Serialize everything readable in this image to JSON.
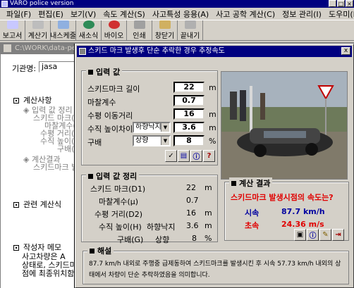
{
  "app": {
    "title": "VARO police version"
  },
  "menu": [
    "파일(F)",
    "편집(E)",
    "보기(V)",
    "속도 계산(S)",
    "사고특성 응용(A)",
    "사고 공학 계산(C)",
    "정보 관리(I)",
    "도우미(H)"
  ],
  "toolbar": [
    {
      "label": "보고서",
      "icon": "report-icon",
      "color": "#c8c8ff"
    },
    {
      "label": "계산기",
      "icon": "calculator-icon",
      "color": "#bdbdbd"
    },
    {
      "label": "내스케줄",
      "icon": "schedule-icon",
      "color": "#8fb0e0"
    },
    {
      "label": "새소식",
      "icon": "globe-icon",
      "color": "#2e8b57"
    },
    {
      "label": "바이오",
      "icon": "bio-icon",
      "color": "#d03030"
    },
    {
      "label": "인쇄",
      "icon": "print-icon",
      "color": "#a0a0a0"
    },
    {
      "label": "창닫기",
      "icon": "close-window-icon",
      "color": "#d0b060"
    },
    {
      "label": "끝내기",
      "icon": "exit-icon",
      "color": "#b0b0b0"
    }
  ],
  "doc": {
    "title": "C:\\WORK\\data-ped",
    "agency_label": "기관명:",
    "agency_value": "jasa",
    "section_calc": "계산사항",
    "calc_lines": [
      "입력 값 정리",
      "스키드 마크(D",
      "마찰계수(",
      "수평 거리(D",
      "수직 높이(H",
      "구배("
    ],
    "result_lines": [
      "계산결과",
      "스키드마크 발생"
    ],
    "section_related": "관련 계산식",
    "section_memo": "작성자 메모",
    "memo_lines": [
      "사고차량은 A",
      "상태로, 스키드마",
      "점에 최종위치함"
    ]
  },
  "dialog": {
    "title": "스키드 마크 발생후 단순 추락한 경우 추정속도",
    "close": "x",
    "input_title": "입력 값",
    "inputs": {
      "skid": {
        "label": "스키드마크 길이",
        "value": "22",
        "unit": "m"
      },
      "friction": {
        "label": "마찰계수",
        "value": "0.7",
        "unit": ""
      },
      "distance": {
        "label": "수평 이동거리",
        "value": "16",
        "unit": "m"
      },
      "height": {
        "label": "수직 높이차이",
        "select": "하향낙지",
        "value": "3.6",
        "unit": "m"
      },
      "grade": {
        "label": "구배",
        "select": "상향",
        "value": "8",
        "unit": "%"
      }
    },
    "summary_title": "입력 값 정리",
    "summary": [
      {
        "label": "스키드 마크(D1)",
        "mid": "",
        "value": "22",
        "unit": "m"
      },
      {
        "label": "마찰계수(μ)",
        "mid": "",
        "value": "0.7",
        "unit": ""
      },
      {
        "label": "수평 거리(D2)",
        "mid": "",
        "value": "16",
        "unit": "m"
      },
      {
        "label": "수직 높이(H)",
        "mid": "하향낙지",
        "value": "3.6",
        "unit": "m"
      },
      {
        "label": "구배(G)",
        "mid": "상향",
        "value": "8",
        "unit": "%"
      }
    ],
    "result_title": "계산 결과",
    "result_question": "스키드마크 발생시점의 속도는?",
    "result_kmh_label": "시속",
    "result_kmh": "87.7 km/h",
    "result_ms_label": "초속",
    "result_ms": "24.36 m/s",
    "commentary_title": "해설",
    "commentary_text": "87.7 km/h 내외로 주행중 급제동하여 스키드마크를 발생시킨 후 시속 57.73 km/h 내외의 상태에서 차량이 단순 추락하였음을 의미합니다."
  },
  "colors": {
    "titlebar": "#000080",
    "result_red": "#e00000",
    "result_blue": "#0000a0"
  }
}
